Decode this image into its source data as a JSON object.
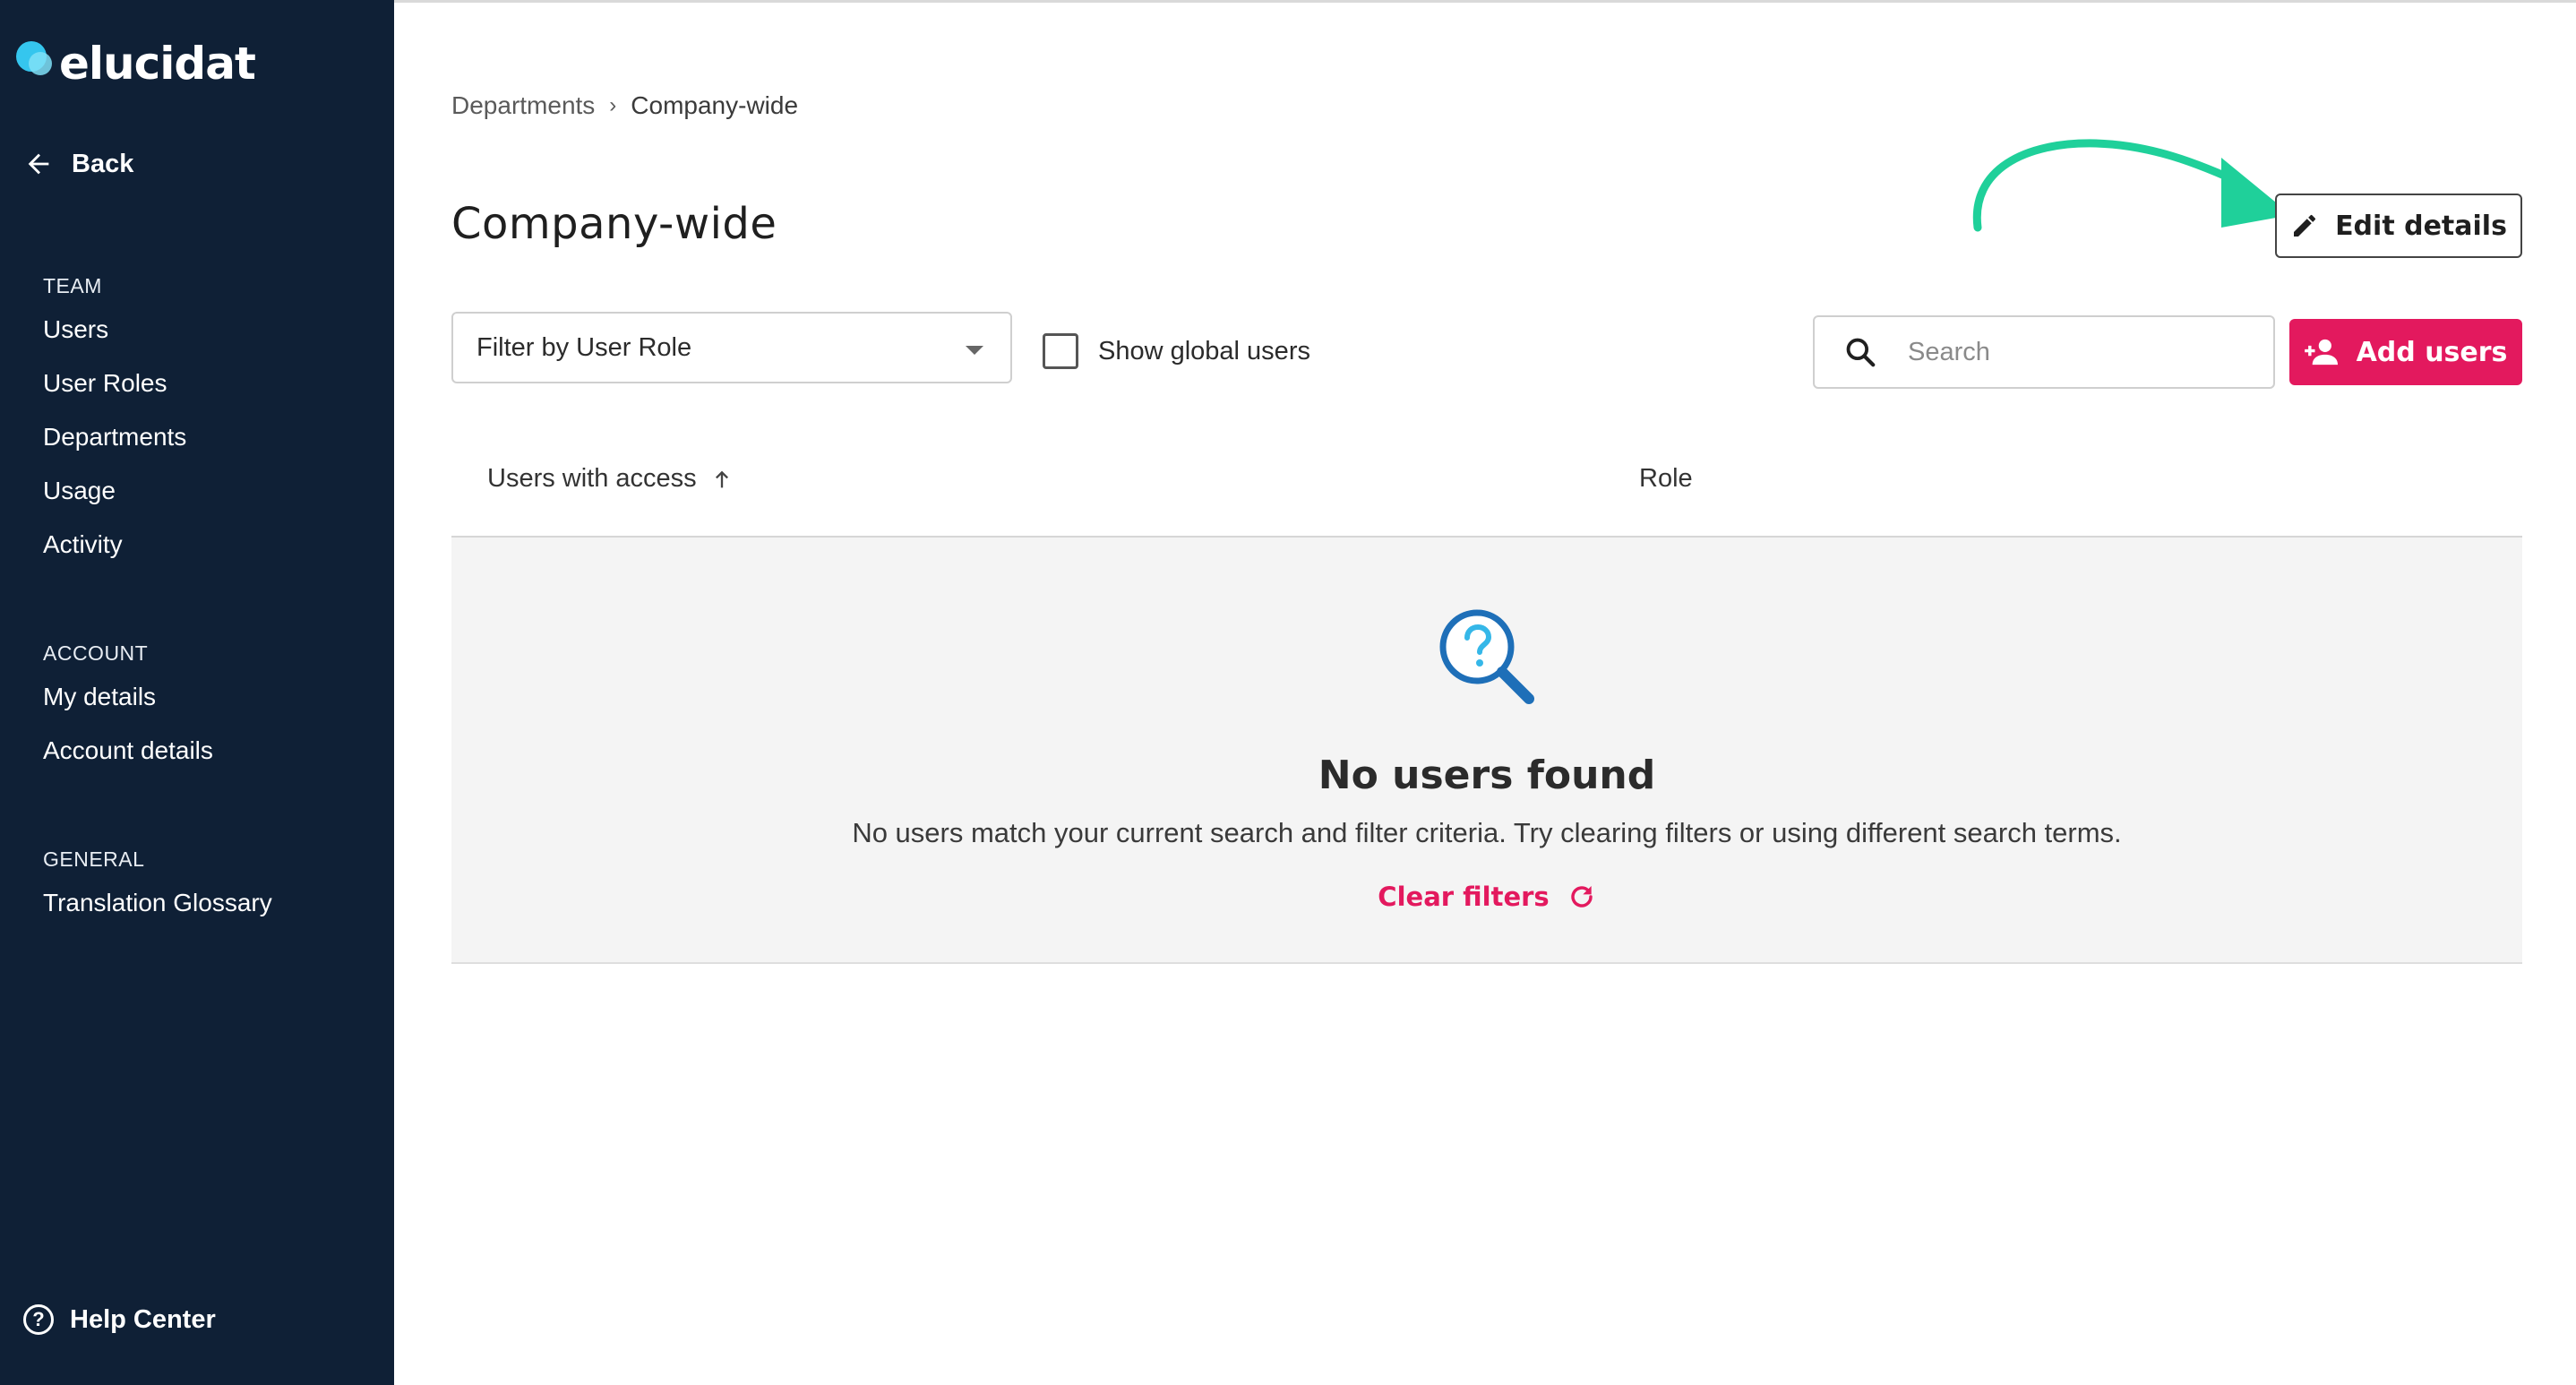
{
  "app": {
    "logo_text": "elucidat"
  },
  "sidebar": {
    "back_label": "Back",
    "sections": [
      {
        "title": "TEAM",
        "items": [
          {
            "label": "Users"
          },
          {
            "label": "User Roles"
          },
          {
            "label": "Departments"
          },
          {
            "label": "Usage"
          },
          {
            "label": "Activity"
          }
        ]
      },
      {
        "title": "ACCOUNT",
        "items": [
          {
            "label": "My details"
          },
          {
            "label": "Account details"
          }
        ]
      },
      {
        "title": "GENERAL",
        "items": [
          {
            "label": "Translation Glossary"
          }
        ]
      }
    ],
    "help_label": "Help Center"
  },
  "breadcrumb": {
    "parent": "Departments",
    "separator": "›",
    "current": "Company-wide"
  },
  "page": {
    "title": "Company-wide",
    "edit_label": "Edit details"
  },
  "toolbar": {
    "filter_label": "Filter by User Role",
    "global_users_label": "Show global users",
    "global_users_checked": false,
    "search_placeholder": "Search",
    "search_value": "",
    "add_users_label": "Add users"
  },
  "table": {
    "columns": [
      {
        "label": "Users with access",
        "sort": "ascending"
      },
      {
        "label": "Role"
      }
    ]
  },
  "empty_state": {
    "title": "No users found",
    "description": "No users match your current search and filter criteria. Try clearing filters or using different search terms.",
    "clear_label": "Clear filters"
  },
  "colors": {
    "sidebar_bg": "#0f2036",
    "accent": "#e3195e",
    "annotation_arrow": "#1fd09a",
    "icon_blue": "#1e6fb8"
  },
  "icons": {
    "back": "arrow-left-icon",
    "edit": "pencil-icon",
    "search": "magnifier-icon",
    "add": "add-person-icon",
    "sort": "arrow-up-icon",
    "empty": "question-magnifier-icon",
    "clear": "refresh-icon",
    "help": "question-circle-icon"
  }
}
